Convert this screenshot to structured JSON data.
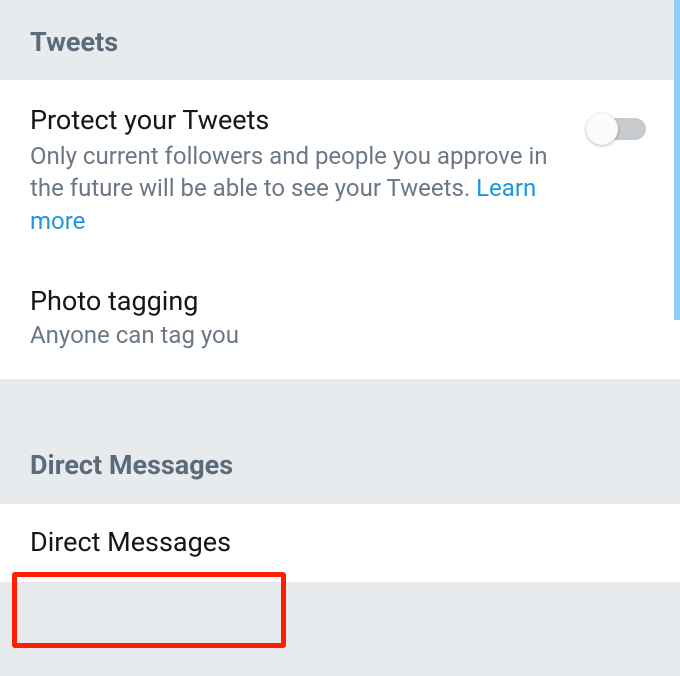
{
  "sections": {
    "tweets": {
      "header": "Tweets",
      "protect": {
        "title": "Protect your Tweets",
        "description_prefix": "Only current followers and people you approve in the future will be able to see your Tweets. ",
        "learn_more": "Learn more",
        "toggle_on": false
      },
      "photo_tagging": {
        "title": "Photo tagging",
        "value": "Anyone can tag you"
      }
    },
    "direct_messages": {
      "header": "Direct Messages",
      "item_label": "Direct Messages"
    }
  }
}
